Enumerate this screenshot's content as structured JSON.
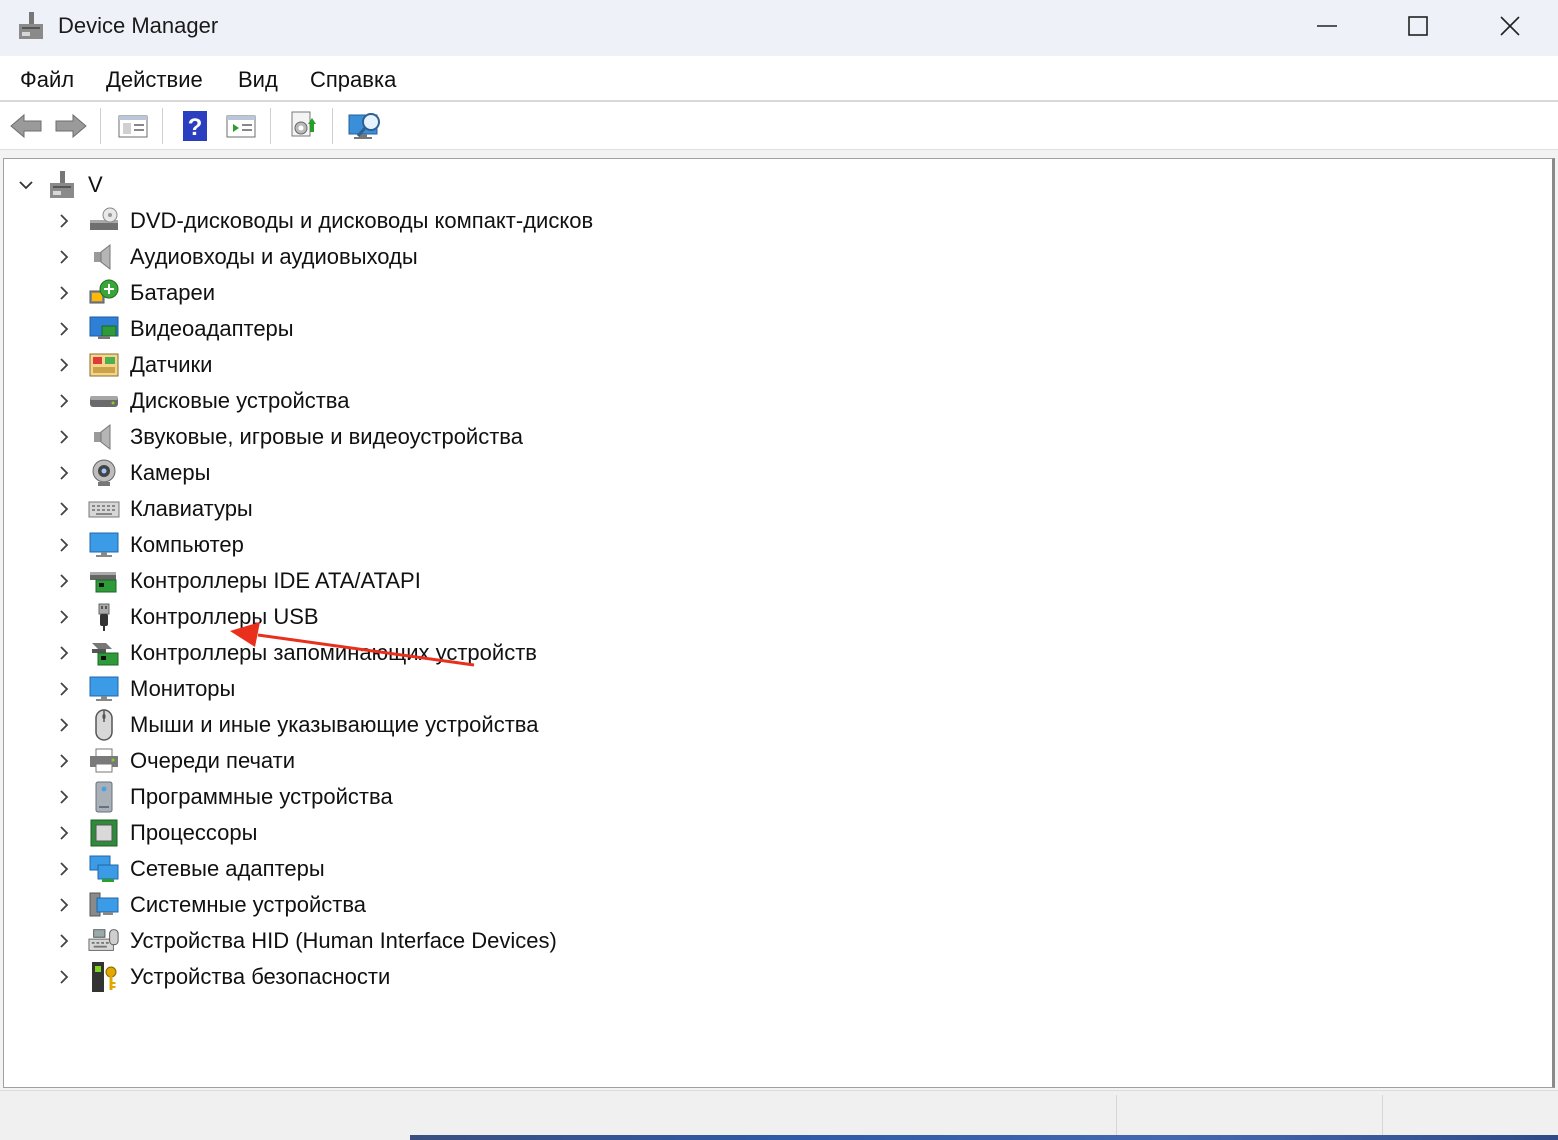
{
  "window": {
    "title": "Device Manager"
  },
  "menu": [
    "Файл",
    "Действие",
    "Вид",
    "Справка"
  ],
  "toolbar": [
    "back-icon",
    "forward-icon",
    "properties-icon",
    "help-icon",
    "show-hide-console-icon",
    "update-driver-icon",
    "scan-hardware-icon"
  ],
  "tree": {
    "root": {
      "label": "V",
      "icon": "computer-root-icon"
    },
    "categories": [
      {
        "label": "DVD-дисководы и дисководы компакт-дисков",
        "icon": "dvd-drive-icon"
      },
      {
        "label": "Аудиовходы и аудиовыходы",
        "icon": "audio-io-icon"
      },
      {
        "label": "Батареи",
        "icon": "battery-icon"
      },
      {
        "label": "Видеоадаптеры",
        "icon": "display-adapter-icon"
      },
      {
        "label": "Датчики",
        "icon": "sensor-icon"
      },
      {
        "label": "Дисковые устройства",
        "icon": "disk-drive-icon"
      },
      {
        "label": "Звуковые, игровые и видеоустройства",
        "icon": "sound-video-icon"
      },
      {
        "label": "Камеры",
        "icon": "camera-icon"
      },
      {
        "label": "Клавиатуры",
        "icon": "keyboard-icon"
      },
      {
        "label": "Компьютер",
        "icon": "computer-icon"
      },
      {
        "label": "Контроллеры IDE ATA/ATAPI",
        "icon": "ide-controller-icon"
      },
      {
        "label": "Контроллеры USB",
        "icon": "usb-controller-icon"
      },
      {
        "label": "Контроллеры запоминающих устройств",
        "icon": "storage-controller-icon"
      },
      {
        "label": "Мониторы",
        "icon": "monitor-icon"
      },
      {
        "label": "Мыши и иные указывающие устройства",
        "icon": "mouse-icon"
      },
      {
        "label": "Очереди печати",
        "icon": "print-queue-icon"
      },
      {
        "label": "Программные устройства",
        "icon": "software-device-icon"
      },
      {
        "label": "Процессоры",
        "icon": "processor-icon"
      },
      {
        "label": "Сетевые адаптеры",
        "icon": "network-adapter-icon"
      },
      {
        "label": "Системные устройства",
        "icon": "system-device-icon"
      },
      {
        "label": "Устройства HID (Human Interface Devices)",
        "icon": "hid-icon"
      },
      {
        "label": "Устройства безопасности",
        "icon": "security-device-icon"
      }
    ]
  },
  "colors": {
    "annotation": "#e8301c",
    "accent": "#2e7fd6"
  }
}
